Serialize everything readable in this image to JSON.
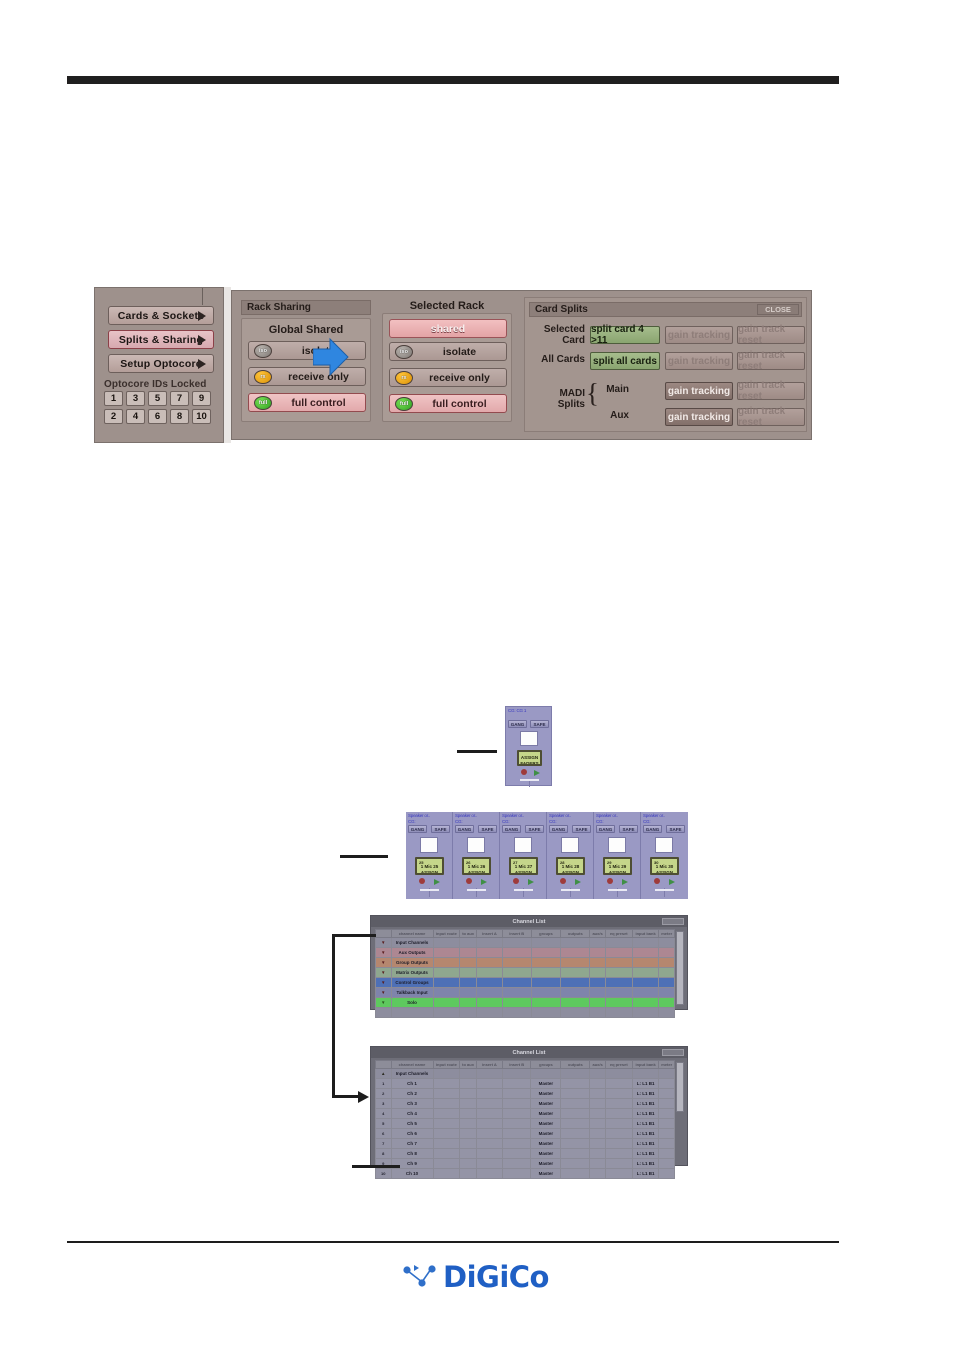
{
  "page": {
    "logo_text": "DiGiCo"
  },
  "figure_splits_sharing": {
    "nav": {
      "items": [
        {
          "label": "Cards & Sockets",
          "selected": false
        },
        {
          "label": "Splits & Sharing",
          "selected": true
        },
        {
          "label": "Setup Optocore",
          "selected": false
        }
      ],
      "locked_header": "Optocore IDs Locked",
      "locked_row1": [
        "1",
        "3",
        "5",
        "7",
        "9"
      ],
      "locked_row2": [
        "2",
        "4",
        "6",
        "8",
        "10"
      ]
    },
    "rack_sharing": {
      "title": "Rack Sharing",
      "global_shared_label": "Global Shared",
      "global_buttons": [
        {
          "led": "iso",
          "led_text": "iso",
          "label": "isolate",
          "active": false
        },
        {
          "led": "rx",
          "led_text": "rx",
          "label": "receive only",
          "active": false
        },
        {
          "led": "full",
          "led_text": "full",
          "label": "full control",
          "active": true
        }
      ]
    },
    "selected_rack": {
      "title": "Selected Rack",
      "shared_label": "shared",
      "buttons": [
        {
          "led": "iso",
          "led_text": "iso",
          "label": "isolate",
          "active": false
        },
        {
          "led": "rx",
          "led_text": "rx",
          "label": "receive only",
          "active": false
        },
        {
          "led": "full",
          "led_text": "full",
          "label": "full control",
          "active": true
        }
      ]
    },
    "card_splits": {
      "title": "Card Splits",
      "close_label": "CLOSE",
      "rows": [
        {
          "label_line1": "Selected",
          "label_line2": "Card",
          "action": {
            "label": "split card 4 >11",
            "style": "green"
          },
          "tracking": {
            "label": "gain tracking",
            "style": "dim"
          },
          "reset": {
            "label": "gain track reset",
            "style": "dim"
          }
        },
        {
          "label_line1": "All Cards",
          "label_line2": "",
          "action": {
            "label": "split all cards",
            "style": "green"
          },
          "tracking": {
            "label": "gain tracking",
            "style": "dim"
          },
          "reset": {
            "label": "gain track reset",
            "style": "dim"
          }
        }
      ],
      "madi": {
        "label_line1": "MADI",
        "label_line2": "Splits",
        "rows": [
          {
            "label": "Main",
            "tracking": {
              "label": "gain tracking",
              "style": "on"
            },
            "reset": {
              "label": "gain track reset",
              "style": "dim"
            }
          },
          {
            "label": "Aux",
            "tracking": {
              "label": "gain tracking",
              "style": "on"
            },
            "reset": {
              "label": "gain track reset",
              "style": "dim"
            }
          }
        ]
      }
    }
  },
  "figure_assign": {
    "single_strip": {
      "top_label1": "CG: CG 1",
      "gang_label": "GANG",
      "safe_label": "SAFE",
      "lcd_num": "",
      "lcd_line1": "ASSIGN",
      "lcd_line2": "FADERS"
    },
    "strip_row": [
      {
        "top_label1": "Speaker or..",
        "top_label2": "CG:",
        "gang_label": "GANG",
        "safe_label": "SAFE",
        "lcd_num": "25",
        "lcd_line1": "1 Mic 25",
        "lcd_line2": "ASSIGN"
      },
      {
        "top_label1": "Speaker or..",
        "top_label2": "CG:",
        "gang_label": "GANG",
        "safe_label": "SAFE",
        "lcd_num": "26",
        "lcd_line1": "1 Mic 26",
        "lcd_line2": "ASSIGN"
      },
      {
        "top_label1": "Speaker or..",
        "top_label2": "CG:",
        "gang_label": "GANG",
        "safe_label": "SAFE",
        "lcd_num": "27",
        "lcd_line1": "1 Mic 27",
        "lcd_line2": "ASSIGN"
      },
      {
        "top_label1": "Speaker or..",
        "top_label2": "CG:",
        "gang_label": "GANG",
        "safe_label": "SAFE",
        "lcd_num": "28",
        "lcd_line1": "1 Mic 28",
        "lcd_line2": "ASSIGN"
      },
      {
        "top_label1": "Speaker or..",
        "top_label2": "CG:",
        "gang_label": "GANG",
        "safe_label": "SAFE",
        "lcd_num": "29",
        "lcd_line1": "1 Mic 29",
        "lcd_line2": "ASSIGN"
      },
      {
        "top_label1": "Speaker or..",
        "top_label2": "CG:",
        "gang_label": "GANG",
        "safe_label": "SAFE",
        "lcd_num": "30",
        "lcd_line1": "1 Mic 30",
        "lcd_line2": "ASSIGN"
      }
    ],
    "channel_list_collapsed": {
      "title": "Channel List",
      "columns": [
        "",
        "channel name",
        "input route",
        "to aux",
        "insert A",
        "insert B",
        "groups",
        "outputs",
        "aux/s",
        "eq preset",
        "input bank",
        "meter"
      ],
      "rows": [
        {
          "name": "Input Channels",
          "color": "#8d8d9e"
        },
        {
          "name": "Aux Outputs",
          "color": "#ad8792"
        },
        {
          "name": "Group Outputs",
          "color": "#b5876f"
        },
        {
          "name": "Matrix Outputs",
          "color": "#8fa78f"
        },
        {
          "name": "Control Groups",
          "color": "#4e70b6"
        },
        {
          "name": "Talkback Input",
          "color": "#7f84ab"
        },
        {
          "name": "Solo",
          "color": "#5ec95e"
        }
      ]
    },
    "channel_list_expanded": {
      "title": "Channel List",
      "columns": [
        "",
        "channel name",
        "input route",
        "to aux",
        "insert A",
        "insert B",
        "groups",
        "outputs",
        "aux/s",
        "eq preset",
        "input bank",
        "meter"
      ],
      "header_row": {
        "name": "Input Channels"
      },
      "rows": [
        {
          "idx": "1",
          "name": "Ch 1",
          "groups": "Master",
          "bank": "L: L1 B1"
        },
        {
          "idx": "2",
          "name": "Ch 2",
          "groups": "Master",
          "bank": "L: L1 B1"
        },
        {
          "idx": "3",
          "name": "Ch 3",
          "groups": "Master",
          "bank": "L: L1 B1"
        },
        {
          "idx": "4",
          "name": "Ch 4",
          "groups": "Master",
          "bank": "L: L1 B1"
        },
        {
          "idx": "5",
          "name": "Ch 5",
          "groups": "Master",
          "bank": "L: L1 B1"
        },
        {
          "idx": "6",
          "name": "Ch 6",
          "groups": "Master",
          "bank": "L: L1 B1"
        },
        {
          "idx": "7",
          "name": "Ch 7",
          "groups": "Master",
          "bank": "L: L1 B1"
        },
        {
          "idx": "8",
          "name": "Ch 8",
          "groups": "Master",
          "bank": "L: L1 B1"
        },
        {
          "idx": "9",
          "name": "Ch 9",
          "groups": "Master",
          "bank": "L: L1 B1"
        },
        {
          "idx": "10",
          "name": "Ch 10",
          "groups": "Master",
          "bank": "L: L1 B1"
        }
      ]
    }
  }
}
